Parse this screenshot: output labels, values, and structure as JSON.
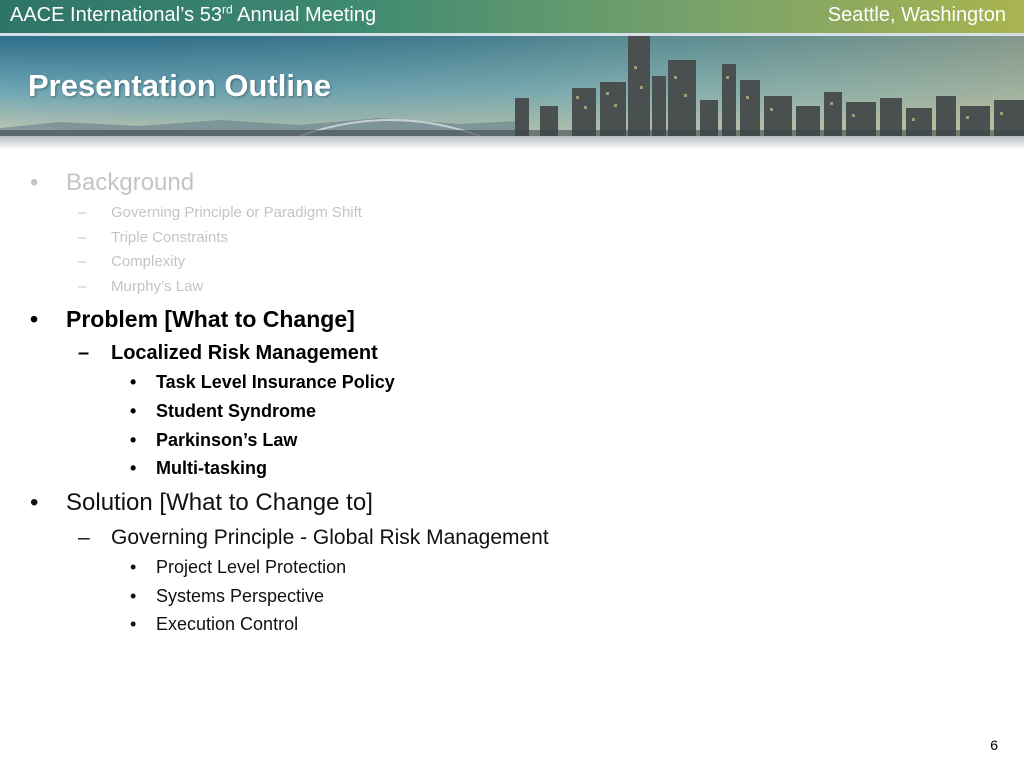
{
  "header": {
    "meeting_prefix": "AACE International’s 53",
    "meeting_sup": "rd",
    "meeting_suffix": " Annual Meeting",
    "location": "Seattle, Washington"
  },
  "slide": {
    "title": "Presentation Outline",
    "page_number": "6"
  },
  "outline": {
    "background": {
      "label": "Background",
      "items": [
        "Governing Principle or Paradigm Shift",
        "Triple Constraints",
        "Complexity",
        "Murphy’s Law"
      ]
    },
    "problem": {
      "label": "Problem [What to Change]",
      "sub": {
        "label": "Localized Risk Management",
        "items": [
          "Task Level Insurance Policy",
          "Student Syndrome",
          "Parkinson’s Law",
          "Multi-tasking"
        ]
      }
    },
    "solution": {
      "label": "Solution [What to Change to]",
      "sub": {
        "label": "Governing Principle - Global Risk Management",
        "items": [
          "Project Level Protection",
          "Systems Perspective",
          "Execution Control"
        ]
      }
    }
  },
  "colors": {
    "faded_text": "#c2c4c6",
    "header_start": "#2e7468",
    "header_end": "#a9b44e"
  }
}
